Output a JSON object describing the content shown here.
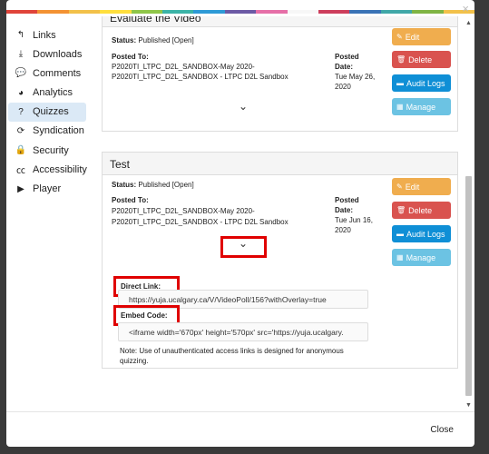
{
  "rainbow_colors": [
    "#e0443a",
    "#f39233",
    "#f2c14a",
    "#ffdf3d",
    "#8fc649",
    "#3bb4a7",
    "#2d9ad6",
    "#6c5aa5",
    "#e66fa7",
    "#f7f7f7",
    "#cd3e5c",
    "#3a73b6",
    "#40a7a7",
    "#7fb444",
    "#f2c14a"
  ],
  "modal": {
    "close_icon": "×"
  },
  "sidebar": {
    "items": [
      {
        "label": "Links",
        "icon": "link-icon",
        "glyph": "↰"
      },
      {
        "label": "Downloads",
        "icon": "download-icon",
        "glyph": "⤓"
      },
      {
        "label": "Comments",
        "icon": "comments-icon",
        "glyph": "💬"
      },
      {
        "label": "Analytics",
        "icon": "pie-chart-icon",
        "glyph": "◕"
      },
      {
        "label": "Quizzes",
        "icon": "question-circle-icon",
        "glyph": "?"
      },
      {
        "label": "Syndication",
        "icon": "sync-icon",
        "glyph": "⟳"
      },
      {
        "label": "Security",
        "icon": "lock-icon",
        "glyph": "🔒"
      },
      {
        "label": "Accessibility",
        "icon": "closed-caption-icon",
        "glyph": "㏄"
      },
      {
        "label": "Player",
        "icon": "play-circle-icon",
        "glyph": "▶"
      }
    ]
  },
  "card1": {
    "title": "Evaluate the Video",
    "status_label": "Status:",
    "status_value": " Published [Open]",
    "posted_to_label": "Posted To:",
    "posted_to_line1": "P2020TI_LTPC_D2L_SANDBOX-May 2020-",
    "posted_to_line2": "P2020TI_LTPC_D2L_SANDBOX - LTPC D2L Sandbox",
    "posted_date_label1": "Posted",
    "posted_date_label2": "Date:",
    "posted_date_value1": "Tue May 26,",
    "posted_date_value2": "2020"
  },
  "card2": {
    "title": "Test",
    "status_label": "Status:",
    "status_value": " Published [Open]",
    "posted_to_label": "Posted To:",
    "posted_to_line1": "P2020TI_LTPC_D2L_SANDBOX-May 2020-",
    "posted_to_line2": "P2020TI_LTPC_D2L_SANDBOX - LTPC D2L Sandbox",
    "posted_date_label1": "Posted",
    "posted_date_label2": "Date:",
    "posted_date_value1": "Tue Jun 16,",
    "posted_date_value2": "2020",
    "direct_link_label": "Direct Link:",
    "direct_link_value": "https://yuja.ucalgary.ca/V/VideoPoll/156?withOverlay=true",
    "embed_code_label": "Embed Code:",
    "embed_code_value": "<iframe width='670px' height='570px' src='https://yuja.ucalgary.",
    "note": "Note: Use of unauthenticated access links is designed for anonymous quizzing."
  },
  "buttons": {
    "edit": "Edit",
    "delete": "Delete",
    "audit": "Audit Logs",
    "manage": "Manage"
  },
  "footer": {
    "close": "Close"
  }
}
